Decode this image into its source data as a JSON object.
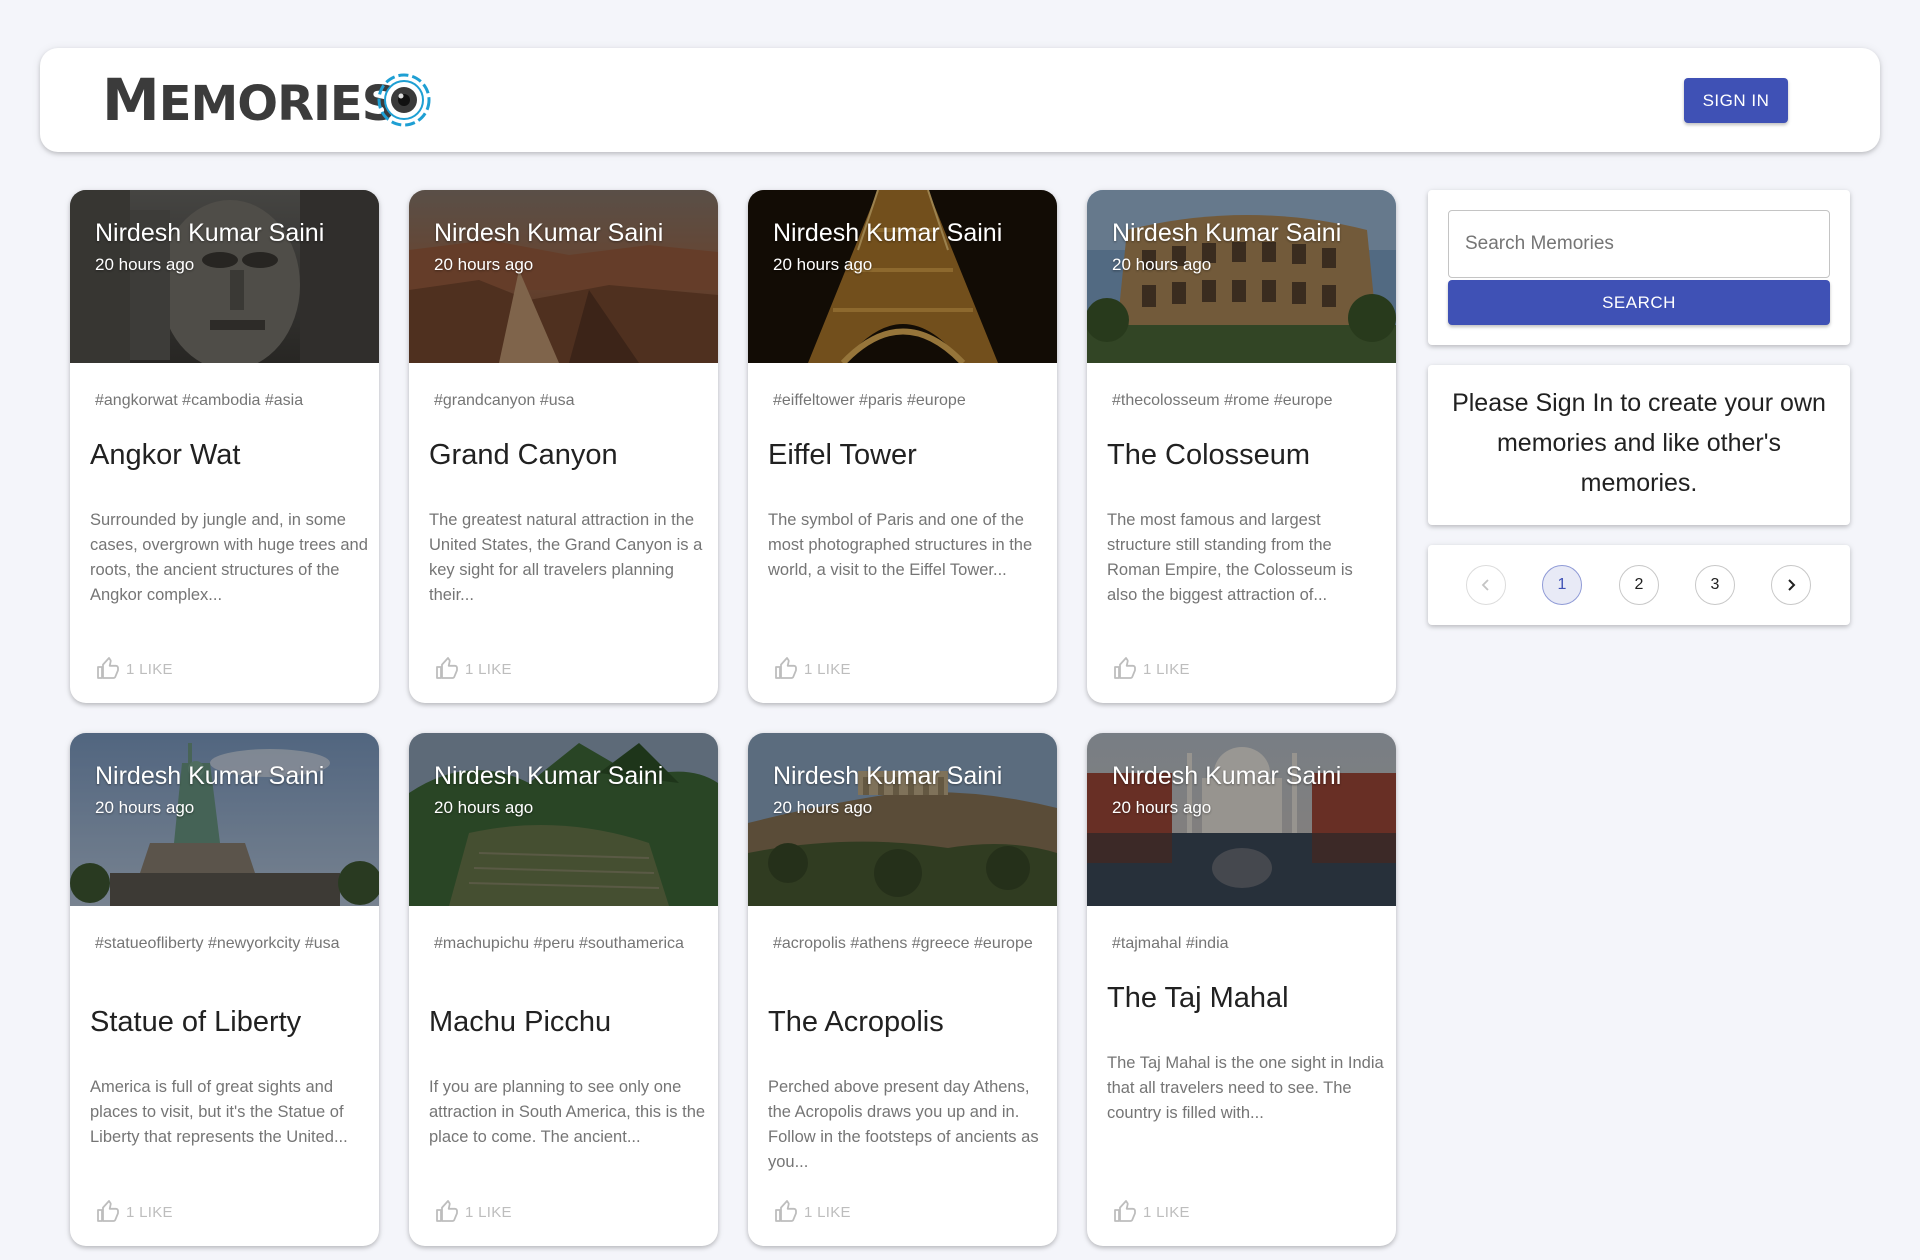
{
  "app": {
    "logo_text_big1": "M",
    "logo_text_small1": "EMORIES",
    "sign_in_label": "SIGN IN"
  },
  "posts": [
    {
      "creator": "Nirdesh Kumar Saini",
      "time": "20 hours ago",
      "tags": "#angkorwat #cambodia #asia",
      "title": "Angkor Wat",
      "message": "Surrounded by jungle and, in some cases, overgrown with huge trees and roots, the ancient structures of the Angkor complex...",
      "likes": "1 LIKE"
    },
    {
      "creator": "Nirdesh Kumar Saini",
      "time": "20 hours ago",
      "tags": "#grandcanyon #usa",
      "title": "Grand Canyon",
      "message": "The greatest natural attraction in the United States, the Grand Canyon is a key sight for all travelers planning their...",
      "likes": "1 LIKE"
    },
    {
      "creator": "Nirdesh Kumar Saini",
      "time": "20 hours ago",
      "tags": "#eiffeltower #paris #europe",
      "title": "Eiffel Tower",
      "message": "The symbol of Paris and one of the most photographed structures in the world, a visit to the Eiffel Tower...",
      "likes": "1 LIKE"
    },
    {
      "creator": "Nirdesh Kumar Saini",
      "time": "20 hours ago",
      "tags": "#thecolosseum #rome #europe",
      "title": "The Colosseum",
      "message": "The most famous and largest structure still standing from the Roman Empire, the Colosseum is also the biggest attraction of...",
      "likes": "1 LIKE"
    },
    {
      "creator": "Nirdesh Kumar Saini",
      "time": "20 hours ago",
      "tags": "#statueofliberty #newyorkcity #usa",
      "title": "Statue of Liberty",
      "message": "America is full of great sights and places to visit, but it's the Statue of Liberty that represents the United...",
      "likes": "1 LIKE"
    },
    {
      "creator": "Nirdesh Kumar Saini",
      "time": "20 hours ago",
      "tags": "#machupichu #peru #southamerica",
      "title": "Machu Picchu",
      "message": "If you are planning to see only one attraction in South America, this is the place to come. The ancient...",
      "likes": "1 LIKE"
    },
    {
      "creator": "Nirdesh Kumar Saini",
      "time": "20 hours ago",
      "tags": "#acropolis #athens #greece #europe",
      "title": "The Acropolis",
      "message": "Perched above present day Athens, the Acropolis draws you up and in. Follow in the footsteps of ancients as you...",
      "likes": "1 LIKE"
    },
    {
      "creator": "Nirdesh Kumar Saini",
      "time": "20 hours ago",
      "tags": "#tajmahal #india",
      "title": "The Taj Mahal",
      "message": "The Taj Mahal is the one sight in India that all travelers need to see. The country is filled with...",
      "likes": "1 LIKE"
    }
  ],
  "sidebar": {
    "search_placeholder": "Search Memories",
    "search_button": "SEARCH",
    "signin_message": "Please Sign In to create your own memories and like other's memories.",
    "pagination": {
      "pages": [
        "1",
        "2",
        "3"
      ],
      "current_page": "1",
      "prev_icon": "chevron-left-icon",
      "next_icon": "chevron-right-icon"
    }
  },
  "colors": {
    "primary": "#3f51b5",
    "background": "#f4f5fa",
    "logo_ring": "#1e9fd3"
  }
}
